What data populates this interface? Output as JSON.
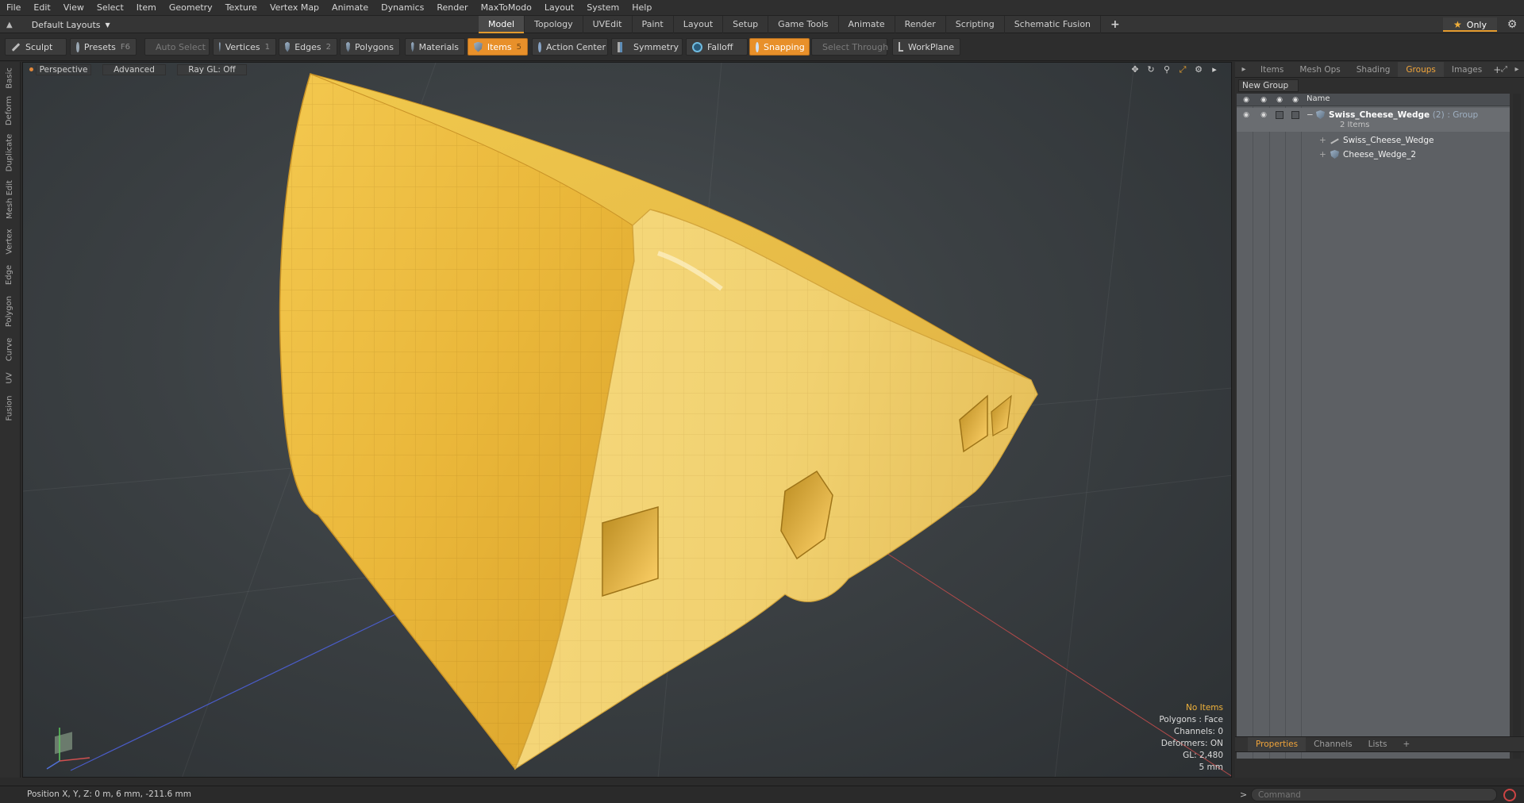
{
  "menu": [
    "File",
    "Edit",
    "View",
    "Select",
    "Item",
    "Geometry",
    "Texture",
    "Vertex Map",
    "Animate",
    "Dynamics",
    "Render",
    "MaxToModo",
    "Layout",
    "System",
    "Help"
  ],
  "layout_selector": "Default Layouts",
  "top_tabs": [
    "Model",
    "Topology",
    "UVEdit",
    "Paint",
    "Layout",
    "Setup",
    "Game Tools",
    "Animate",
    "Render",
    "Scripting",
    "Schematic Fusion"
  ],
  "top_tab_plus": "+",
  "only_label": "Only",
  "toolbar": {
    "sculpt": "Sculpt",
    "presets": "Presets",
    "presets_key": "F6",
    "auto_select": "Auto Select",
    "vertices": "Vertices",
    "vertices_count": "1",
    "edges": "Edges",
    "edges_count": "2",
    "polygons": "Polygons",
    "materials": "Materials",
    "items": "Items",
    "items_count": "5",
    "action_center": "Action Center",
    "symmetry": "Symmetry",
    "falloff": "Falloff",
    "snapping": "Snapping",
    "select_through": "Select Through",
    "workplane": "WorkPlane"
  },
  "left_tabs": [
    "Basic",
    "Deform",
    "Duplicate",
    "Mesh Edit",
    "Vertex",
    "Edge",
    "Polygon",
    "Curve",
    "UV",
    "Fusion"
  ],
  "viewport": {
    "view": "Perspective",
    "shading": "Advanced",
    "raygl": "Ray GL: Off",
    "info": {
      "selection": "No Items",
      "polygons": "Polygons : Face",
      "channels": "Channels: 0",
      "deformers": "Deformers: ON",
      "gl": "GL: 2,480",
      "scale": "5 mm"
    }
  },
  "right_panel": {
    "tabs": [
      "Items",
      "Mesh Ops",
      "Shading",
      "Groups",
      "Images"
    ],
    "active_tab": "Groups",
    "tab_plus": "+",
    "new_group": "New Group",
    "column_name": "Name",
    "group": {
      "name": "Swiss_Cheese_Wedge",
      "count": "(2)",
      "type": ": Group",
      "sub": "2 Items"
    },
    "children": [
      "Swiss_Cheese_Wedge",
      "Cheese_Wedge_2"
    ],
    "bottom_tabs": [
      "Properties",
      "Channels",
      "Lists"
    ],
    "bottom_tab_plus": "+"
  },
  "status": {
    "position": "Position X, Y, Z:  0 m, 6 mm, -211.6 mm"
  },
  "command": {
    "prompt": ">",
    "placeholder": "Command"
  },
  "colors": {
    "accent": "#e8902a",
    "cheese_light": "#f5d57a",
    "cheese_dark": "#e0a528"
  }
}
